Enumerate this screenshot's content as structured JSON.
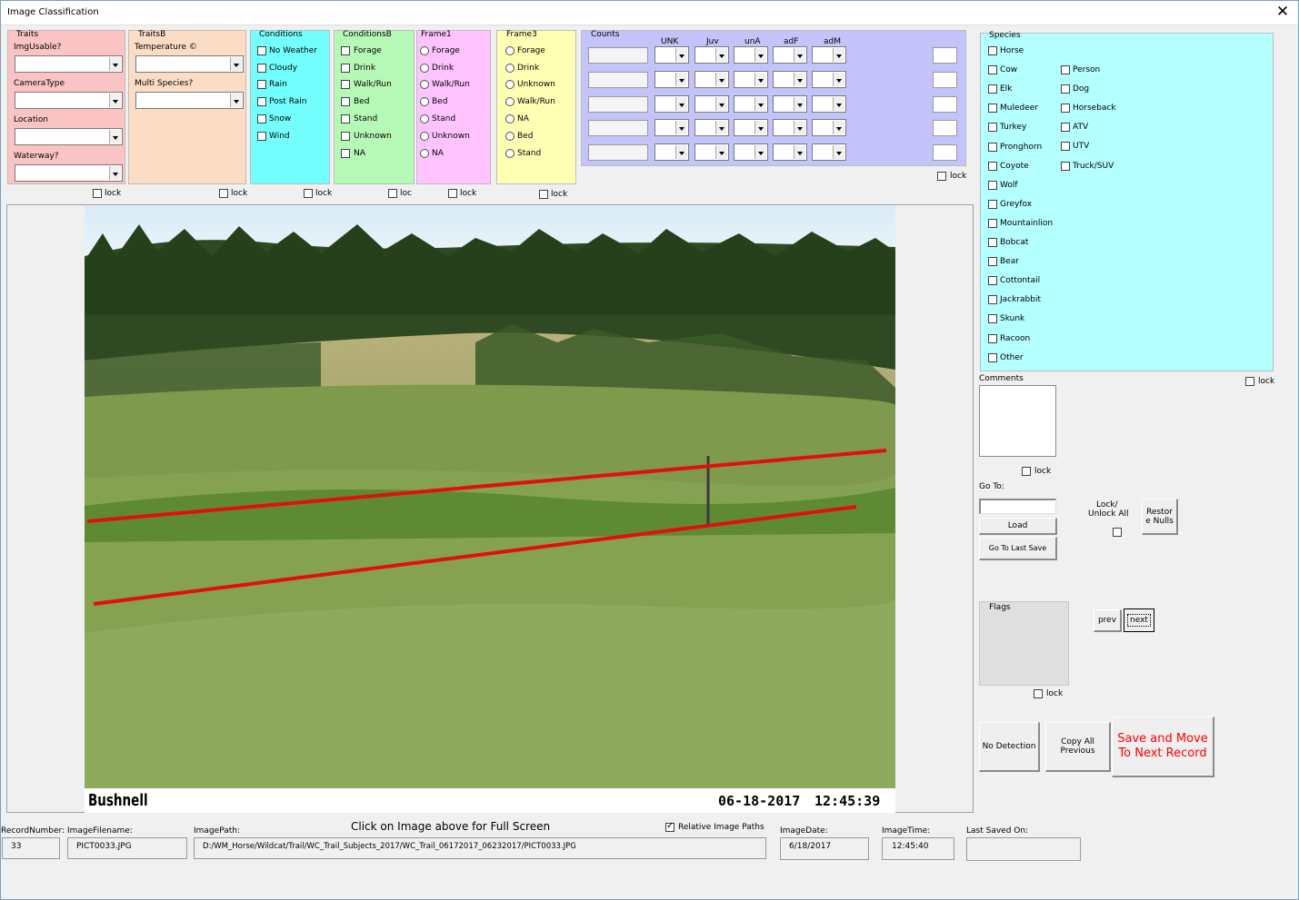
{
  "window": {
    "title": "Image Classification",
    "close_glyph": "✕"
  },
  "traits": {
    "title": "Traits",
    "imgusable": "ImgUsable?",
    "cameratype": "CameraType",
    "location": "Location",
    "waterway": "Waterway?",
    "lock": "lock"
  },
  "traitsb": {
    "title": "TraitsB",
    "temperature": "Temperature ©",
    "multi": "Multi Species?",
    "lock": "lock"
  },
  "conditions": {
    "title": "Conditions",
    "items": [
      "No Weather",
      "Cloudy",
      "Rain",
      "Post Rain",
      "Snow",
      "Wind"
    ],
    "lock": "lock"
  },
  "conditionsb": {
    "title": "ConditionsB",
    "items": [
      "Forage",
      "Drink",
      "Walk/Run",
      "Bed",
      "Stand",
      "Unknown",
      "NA"
    ],
    "lock": "loc"
  },
  "frame1": {
    "title": "Frame1",
    "items": [
      "Forage",
      "Drink",
      "Walk/Run",
      "Bed",
      "Stand",
      "Unknown",
      "NA"
    ],
    "lock": "lock"
  },
  "frame3": {
    "title": "Frame3",
    "items": [
      "Forage",
      "Drink",
      "Unknown",
      "Walk/Run",
      "NA",
      "Bed",
      "Stand"
    ],
    "lock": "lock"
  },
  "counts": {
    "title": "Counts",
    "columns": [
      "UNK",
      "Juv",
      "unA",
      "adF",
      "adM"
    ],
    "lock": "lock"
  },
  "species": {
    "title": "Species",
    "col1": [
      "Horse",
      "Cow",
      "Elk",
      "Muledeer",
      "Turkey",
      "Pronghorn",
      "Coyote",
      "Wolf",
      "Greyfox",
      "Mountainlion",
      "Bobcat",
      "Bear",
      "Cottontail",
      "Jackrabbit",
      "Skunk",
      "Racoon",
      "Other"
    ],
    "col2": [
      "Person",
      "Dog",
      "Horseback",
      "ATV",
      "UTV",
      "Truck/SUV"
    ],
    "lock": "lock"
  },
  "comments": {
    "label": "Comments",
    "lock": "lock"
  },
  "goto": {
    "label": "Go To:",
    "load": "Load",
    "last_save": "Go To Last Save"
  },
  "lockall": {
    "label1": "Lock/",
    "label2": "Unlock All"
  },
  "restore": {
    "label1": "Restor",
    "label2": "e Nulls"
  },
  "flags": {
    "label": "Flags",
    "lock": "lock"
  },
  "nav": {
    "prev": "prev",
    "next": "next"
  },
  "actions": {
    "no_detection": "No Detection",
    "copy1": "Copy All",
    "copy2": "Previous",
    "save1": "Save and Move",
    "save2": "To Next Record"
  },
  "photo": {
    "brand": "Bushnell",
    "date": "06-18-2017",
    "time": "12:45:39"
  },
  "bottom": {
    "click_hint": "Click on Image above for Full Screen",
    "relative_paths": "Relative Image Paths",
    "record_number_label": "RecordNumber:",
    "record_number": "33",
    "filename_label": "ImageFilename:",
    "filename": "PICT0033.JPG",
    "path_label": "ImagePath:",
    "path": "D:/WM_Horse/Wildcat/Trail/WC_Trail_Subjects_2017/WC_Trail_06172017_06232017/PICT0033.JPG",
    "date_label": "ImageDate:",
    "date": "6/18/2017",
    "time_label": "ImageTime:",
    "time": "12:45:40",
    "saved_label": "Last Saved On:",
    "saved": ""
  },
  "colors": {
    "traits": "#fbc4c4",
    "traitsb": "#fbdcc4",
    "conditions": "#74ffff",
    "conditionsb": "#b6f9b6",
    "frame1": "#ffc4ff",
    "frame3": "#ffffb4",
    "counts": "#c4c4fa",
    "species": "#b4ffff",
    "save_text": "#ff0000",
    "line": "#e01010"
  }
}
